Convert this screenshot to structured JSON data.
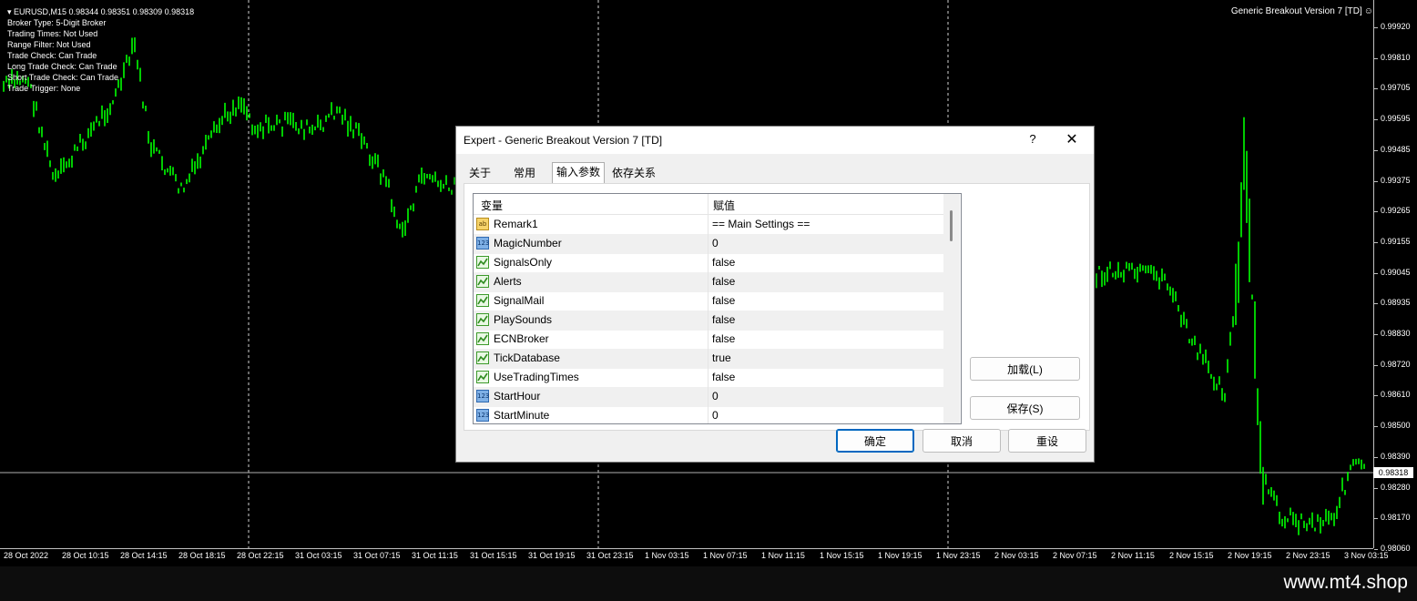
{
  "chart": {
    "info_lines": [
      "EURUSD,M15  0.98344 0.98351 0.98309 0.98318",
      "Broker Type: 5-Digit Broker",
      "Trading Times: Not Used",
      "Range Filter: Not Used",
      "Trade Check: Can Trade",
      "Long Trade Check: Can Trade",
      "Short Trade Check: Can Trade",
      "Trade Trigger: None"
    ],
    "ea_label": "Generic Breakout Version 7 [TD]",
    "price_ticks": [
      "0.99920",
      "0.99810",
      "0.99705",
      "0.99595",
      "0.99485",
      "0.99375",
      "0.99265",
      "0.99155",
      "0.99045",
      "0.98935",
      "0.98830",
      "0.98720",
      "0.98610",
      "0.98500",
      "0.98390",
      "0.98280",
      "0.98170",
      "0.98060"
    ],
    "current_price": "0.98318",
    "time_ticks": [
      "28 Oct 2022",
      "28 Oct 10:15",
      "28 Oct 14:15",
      "28 Oct 18:15",
      "28 Oct 22:15",
      "31 Oct 03:15",
      "31 Oct 07:15",
      "31 Oct 11:15",
      "31 Oct 15:15",
      "31 Oct 19:15",
      "31 Oct 23:15",
      "1 Nov 03:15",
      "1 Nov 07:15",
      "1 Nov 11:15",
      "1 Nov 15:15",
      "1 Nov 19:15",
      "1 Nov 23:15",
      "2 Nov 03:15",
      "2 Nov 07:15",
      "2 Nov 11:15",
      "2 Nov 15:15",
      "2 Nov 19:15",
      "2 Nov 23:15",
      "3 Nov 03:15"
    ],
    "candle_color": "#00ff00"
  },
  "dialog": {
    "title": "Expert - Generic Breakout Version 7 [TD]",
    "help": "?",
    "close": "✕",
    "tabs": [
      "关于",
      "常用",
      "输入参数",
      "依存关系"
    ],
    "active_tab": "输入参数",
    "columns": {
      "variable": "变量",
      "value": "赋值"
    },
    "params": [
      {
        "type": "str",
        "icon": "ab",
        "name": "Remark1",
        "value": "== Main Settings =="
      },
      {
        "type": "num",
        "icon": "123",
        "name": "MagicNumber",
        "value": "0"
      },
      {
        "type": "bool",
        "icon": "",
        "name": "SignalsOnly",
        "value": "false"
      },
      {
        "type": "bool",
        "icon": "",
        "name": "Alerts",
        "value": "false"
      },
      {
        "type": "bool",
        "icon": "",
        "name": "SignalMail",
        "value": "false"
      },
      {
        "type": "bool",
        "icon": "",
        "name": "PlaySounds",
        "value": "false"
      },
      {
        "type": "bool",
        "icon": "",
        "name": "ECNBroker",
        "value": "false"
      },
      {
        "type": "bool",
        "icon": "",
        "name": "TickDatabase",
        "value": "true"
      },
      {
        "type": "bool",
        "icon": "",
        "name": "UseTradingTimes",
        "value": "false"
      },
      {
        "type": "num",
        "icon": "123",
        "name": "StartHour",
        "value": "0"
      },
      {
        "type": "num",
        "icon": "123",
        "name": "StartMinute",
        "value": "0"
      }
    ],
    "buttons": {
      "load": "加载(L)",
      "save": "保存(S)",
      "ok": "确定",
      "cancel": "取消",
      "reset": "重设"
    }
  },
  "footer": {
    "watermark": "www.mt4.shop"
  }
}
